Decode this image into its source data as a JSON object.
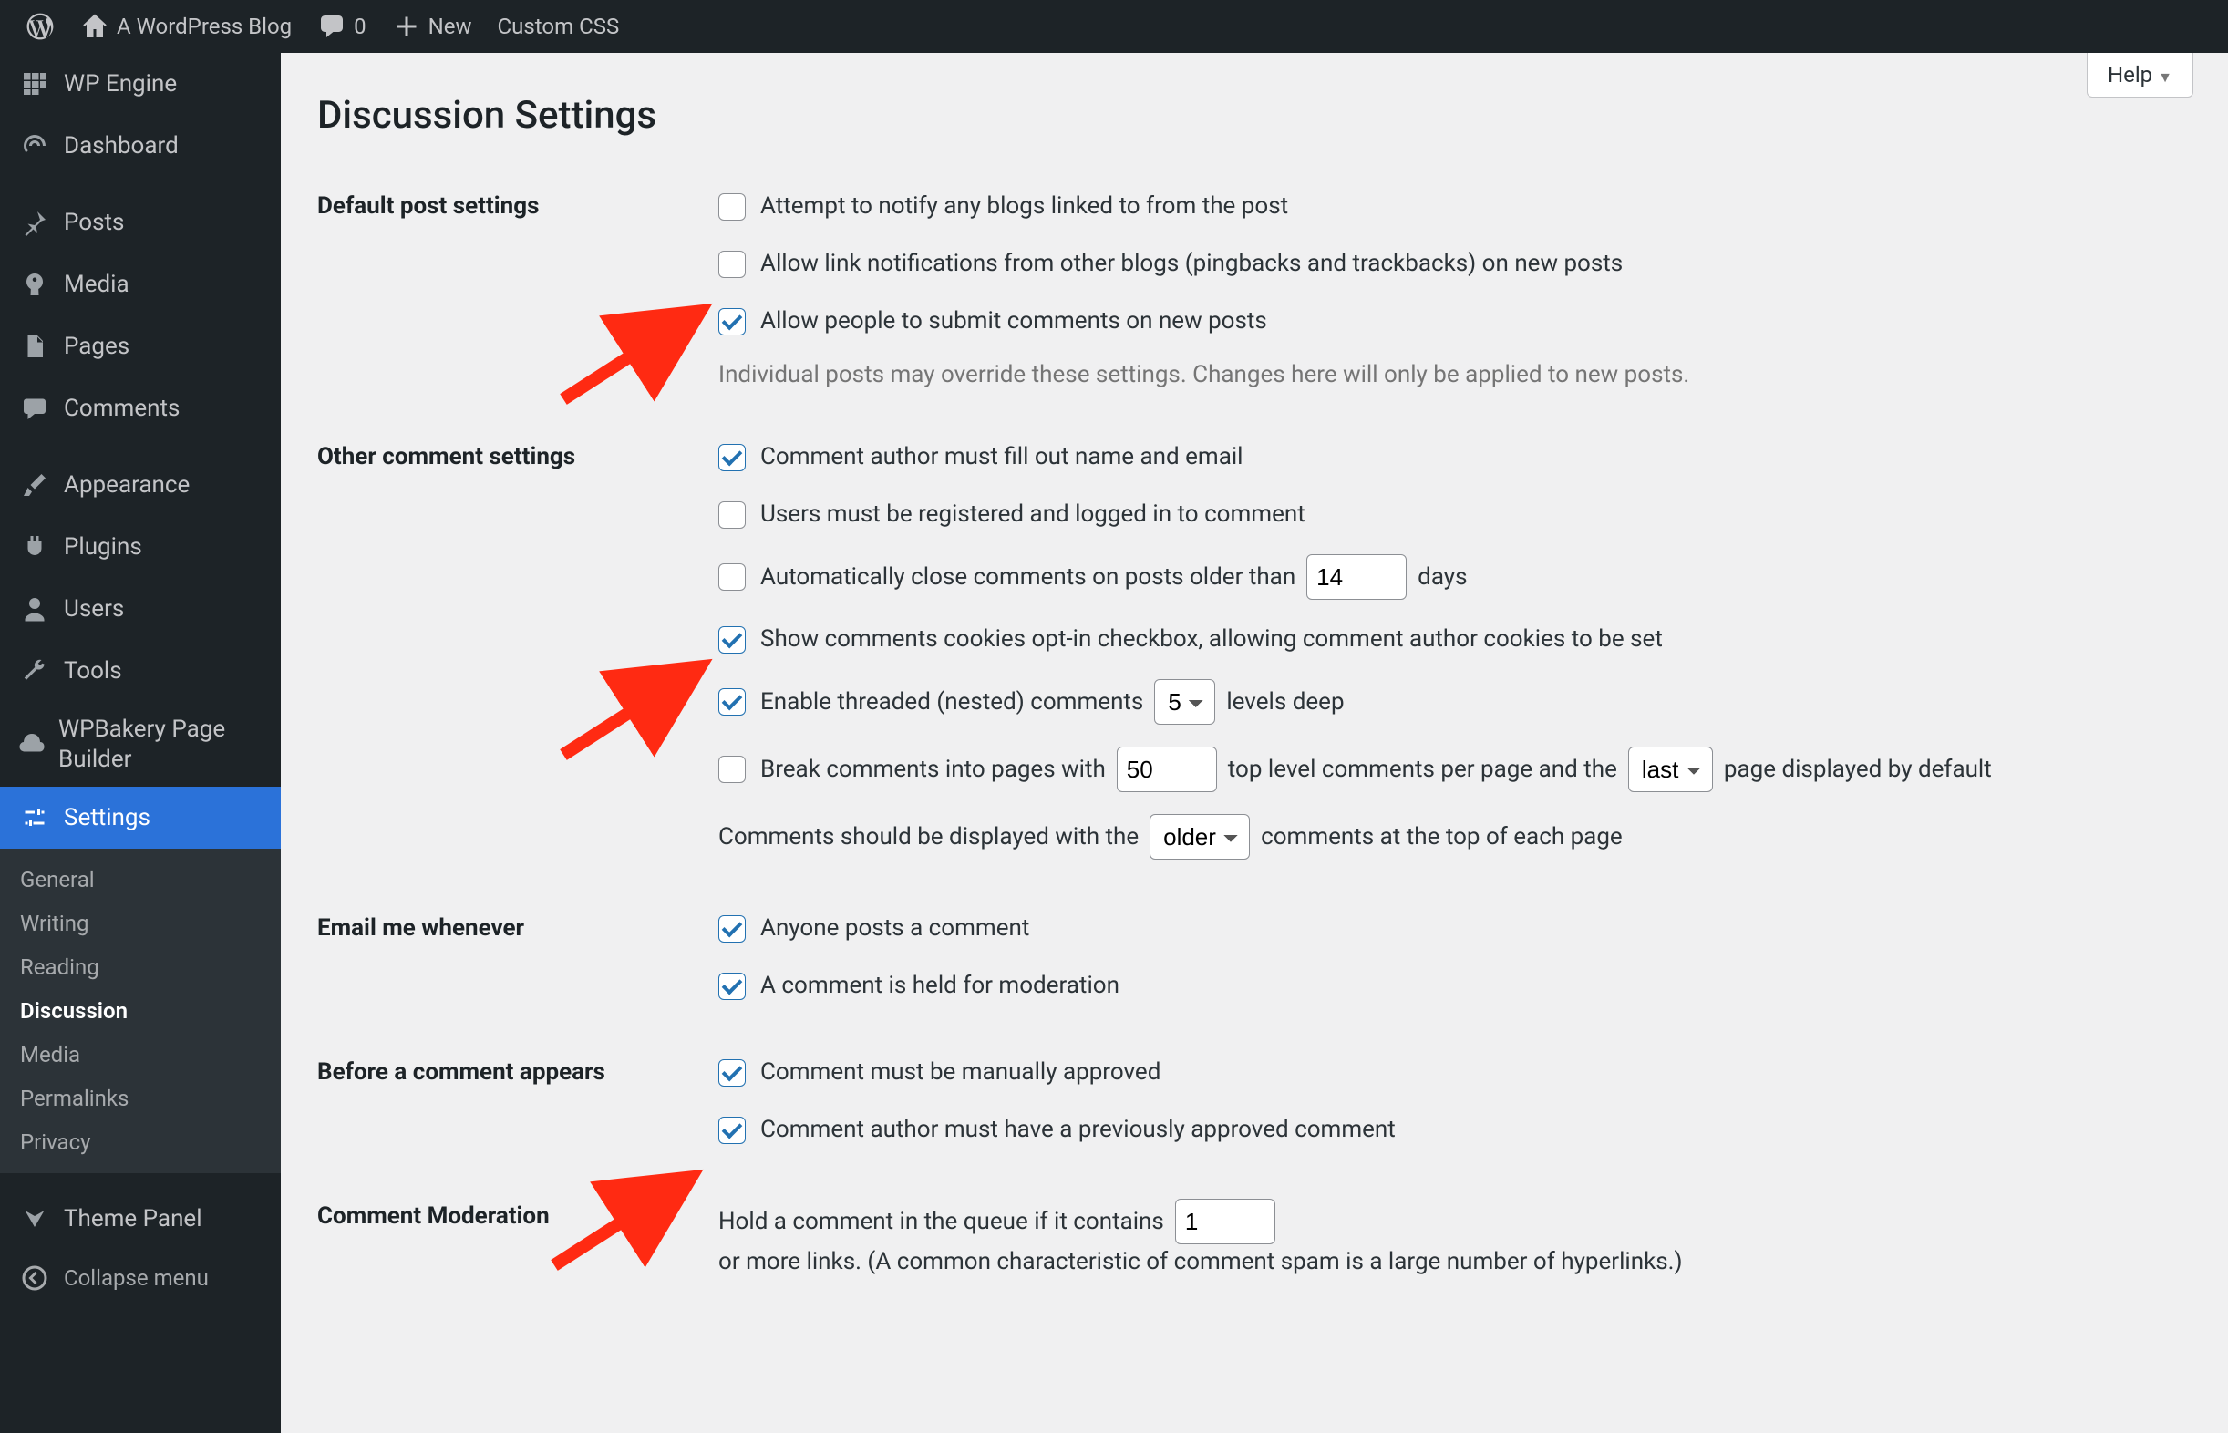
{
  "adminbar": {
    "site_name": "A WordPress Blog",
    "comment_count": "0",
    "new_label": "New",
    "custom_css": "Custom CSS"
  },
  "sidebar": {
    "items": [
      {
        "icon": "wpengine",
        "label": "WP Engine"
      },
      {
        "icon": "dashboard",
        "label": "Dashboard"
      },
      {
        "icon": "pin",
        "label": "Posts"
      },
      {
        "icon": "media",
        "label": "Media"
      },
      {
        "icon": "page",
        "label": "Pages"
      },
      {
        "icon": "comment",
        "label": "Comments"
      },
      {
        "icon": "brush",
        "label": "Appearance"
      },
      {
        "icon": "plug",
        "label": "Plugins"
      },
      {
        "icon": "user",
        "label": "Users"
      },
      {
        "icon": "wrench",
        "label": "Tools"
      },
      {
        "icon": "wpbakery",
        "label": "WPBakery Page Builder"
      },
      {
        "icon": "sliders",
        "label": "Settings"
      }
    ],
    "settings_submenu": [
      "General",
      "Writing",
      "Reading",
      "Discussion",
      "Media",
      "Permalinks",
      "Privacy"
    ],
    "theme_panel": "Theme Panel",
    "collapse": "Collapse menu"
  },
  "page": {
    "title": "Discussion Settings",
    "help": "Help"
  },
  "sections": {
    "default_post": {
      "heading": "Default post settings",
      "opt_pingback": "Attempt to notify any blogs linked to from the post",
      "opt_ping_in": "Allow link notifications from other blogs (pingbacks and trackbacks) on new posts",
      "opt_allow_comments": "Allow people to submit comments on new posts",
      "note": "Individual posts may override these settings. Changes here will only be applied to new posts."
    },
    "other": {
      "heading": "Other comment settings",
      "opt_name_email": "Comment author must fill out name and email",
      "opt_registered": "Users must be registered and logged in to comment",
      "opt_autoclose_pre": "Automatically close comments on posts older than",
      "opt_autoclose_days_value": "14",
      "opt_autoclose_post": "days",
      "opt_cookies": "Show comments cookies opt-in checkbox, allowing comment author cookies to be set",
      "opt_threaded_pre": "Enable threaded (nested) comments",
      "opt_threaded_levels": "5",
      "opt_threaded_post": "levels deep",
      "opt_paginate_pre": "Break comments into pages with",
      "opt_paginate_count": "50",
      "opt_paginate_mid": "top level comments per page and the",
      "opt_paginate_page": "last",
      "opt_paginate_post": "page displayed by default",
      "opt_order_pre": "Comments should be displayed with the",
      "opt_order_value": "older",
      "opt_order_post": "comments at the top of each page"
    },
    "email": {
      "heading": "Email me whenever",
      "opt_anyone": "Anyone posts a comment",
      "opt_held": "A comment is held for moderation"
    },
    "before": {
      "heading": "Before a comment appears",
      "opt_manual": "Comment must be manually approved",
      "opt_prev_approved": "Comment author must have a previously approved comment"
    },
    "moderation": {
      "heading": "Comment Moderation",
      "pre": "Hold a comment in the queue if it contains",
      "value": "1",
      "post": "or more links. (A common characteristic of comment spam is a large number of hyperlinks.)"
    }
  }
}
